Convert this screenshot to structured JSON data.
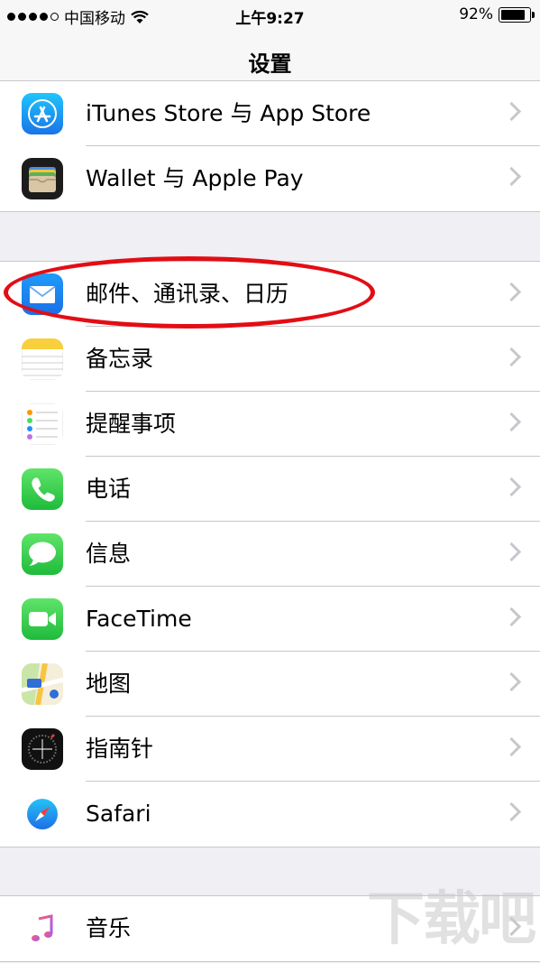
{
  "status": {
    "carrier": "中国移动",
    "time": "上午9:27",
    "battery": "92%"
  },
  "nav": {
    "title": "设置"
  },
  "groups": [
    {
      "rows": [
        {
          "label": "iTunes Store 与 App Store",
          "icon": "app-store-icon"
        },
        {
          "label": "Wallet 与 Apple Pay",
          "icon": "wallet-icon"
        }
      ]
    },
    {
      "rows": [
        {
          "label": "邮件、通讯录、日历",
          "icon": "mail-icon"
        },
        {
          "label": "备忘录",
          "icon": "notes-icon"
        },
        {
          "label": "提醒事项",
          "icon": "reminders-icon"
        },
        {
          "label": "电话",
          "icon": "phone-icon"
        },
        {
          "label": "信息",
          "icon": "messages-icon"
        },
        {
          "label": "FaceTime",
          "icon": "facetime-icon"
        },
        {
          "label": "地图",
          "icon": "maps-icon"
        },
        {
          "label": "指南针",
          "icon": "compass-icon"
        },
        {
          "label": "Safari",
          "icon": "safari-icon"
        }
      ]
    },
    {
      "rows": [
        {
          "label": "音乐",
          "icon": "music-icon"
        }
      ]
    }
  ],
  "watermark": {
    "text": "下载吧"
  },
  "colors": {
    "highlight": "#e30d14",
    "chevron": "#c7c7cc",
    "background": "#efeff4"
  }
}
